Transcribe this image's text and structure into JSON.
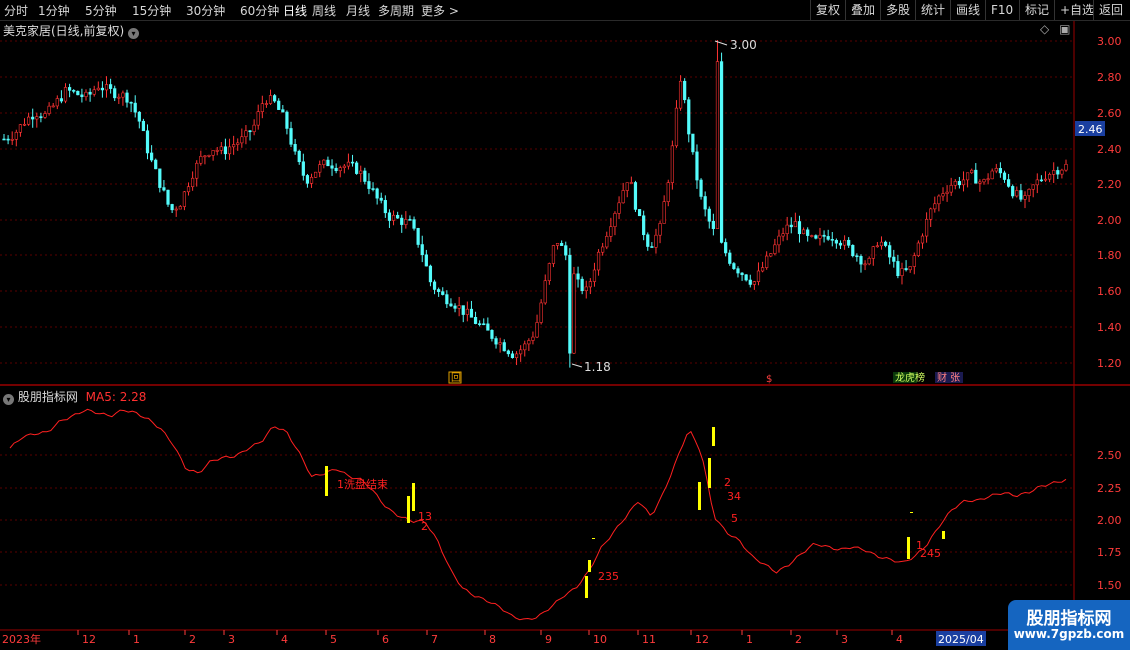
{
  "toolbar": {
    "left": [
      "分时",
      "1分钟",
      "5分钟",
      "15分钟",
      "30分钟",
      "60分钟",
      "日线",
      "周线",
      "月线",
      "多周期",
      "更多 >"
    ],
    "active": "日线",
    "right": [
      "复权",
      "叠加",
      "多股",
      "统计",
      "画线",
      "F10",
      "标记",
      "+自选",
      "返回"
    ]
  },
  "main_panel": {
    "title": "美克家居(日线,前复权)",
    "current_price": "2.46",
    "high_label": "3.00",
    "low_label": "1.18",
    "yaxis_ticks": [
      "3.00",
      "2.80",
      "2.60",
      "2.40",
      "2.20",
      "2.00",
      "1.80",
      "1.60",
      "1.40",
      "1.20"
    ],
    "markers": [
      "回",
      "$",
      "龙虎榜",
      "财 张"
    ]
  },
  "indicator_panel": {
    "title": "股朋指标网",
    "ma_label": "MA5: 2.28",
    "yaxis_ticks": [
      "2.50",
      "2.25",
      "2.00",
      "1.75",
      "1.50"
    ],
    "annotation": "1洗盘结束"
  },
  "time_axis": [
    "2023年",
    "12",
    "1",
    "2",
    "3",
    "4",
    "5",
    "6",
    "7",
    "8",
    "9",
    "10",
    "11",
    "12",
    "1",
    "2",
    "3",
    "4",
    "2025/04"
  ],
  "watermark": {
    "name": "股朋指标网",
    "url": "www.7gpzb.com"
  },
  "colors": {
    "up": "#ff3333",
    "down": "#54fcfc",
    "grid": "#5a0000",
    "signal": "#ffff00",
    "line": "#ff2020",
    "axis_text": "#ff3b3b"
  },
  "chart_data": {
    "type": "candlestick",
    "price_series": [
      2.45,
      2.48,
      2.55,
      2.6,
      2.58,
      2.65,
      2.72,
      2.7,
      2.68,
      2.75,
      2.72,
      2.7,
      2.68,
      2.55,
      2.35,
      2.2,
      2.05,
      2.1,
      2.25,
      2.35,
      2.4,
      2.38,
      2.42,
      2.45,
      2.52,
      2.68,
      2.65,
      2.55,
      2.35,
      2.22,
      2.28,
      2.32,
      2.3,
      2.3,
      2.28,
      2.2,
      2.1,
      2.02,
      2.0,
      1.98,
      1.85,
      1.65,
      1.58,
      1.55,
      1.5,
      1.45,
      1.4,
      1.35,
      1.3,
      1.25,
      1.3,
      1.38,
      1.65,
      1.9,
      1.8,
      1.65,
      1.6,
      1.8,
      1.95,
      2.1,
      2.25,
      2.0,
      1.85,
      1.95,
      2.3,
      2.8,
      2.4,
      2.1,
      1.95,
      1.85,
      1.75,
      1.7,
      1.65,
      1.75,
      1.85,
      1.95,
      1.98,
      1.9,
      1.88,
      1.92,
      1.9,
      1.85,
      1.8,
      1.75,
      1.9,
      1.8,
      1.7,
      1.72,
      1.9,
      2.05,
      2.15,
      2.2,
      2.22,
      2.25,
      2.2,
      2.28,
      2.25,
      2.15,
      2.1,
      2.2,
      2.25,
      2.28,
      2.3
    ],
    "high": 3.0,
    "low": 1.18,
    "last": 2.46,
    "ylim": [
      1.1,
      3.1
    ],
    "ma_series": [
      2.48,
      2.55,
      2.57,
      2.58,
      2.65,
      2.68,
      2.72,
      2.7,
      2.68,
      2.72,
      2.7,
      2.66,
      2.6,
      2.5,
      2.35,
      2.32,
      2.4,
      2.42,
      2.43,
      2.48,
      2.52,
      2.62,
      2.58,
      2.45,
      2.3,
      2.32,
      2.35,
      2.3,
      2.28,
      2.2,
      2.1,
      2.05,
      2.02,
      2.02,
      1.9,
      1.72,
      1.6,
      1.55,
      1.52,
      1.48,
      1.42,
      1.4,
      1.42,
      1.48,
      1.55,
      1.6,
      1.7,
      1.85,
      1.95,
      2.05,
      2.15,
      2.05,
      2.2,
      2.4,
      2.6,
      2.45,
      2.05,
      1.95,
      1.9,
      1.8,
      1.75,
      1.7,
      1.75,
      1.82,
      1.88,
      1.86,
      1.84,
      1.86,
      1.84,
      1.8,
      1.78,
      1.76,
      1.8,
      1.88,
      2.0,
      2.1,
      2.15,
      2.15,
      2.18,
      2.2,
      2.18,
      2.2,
      2.24,
      2.26,
      2.28
    ],
    "ma_ylim": [
      1.35,
      2.75
    ]
  }
}
